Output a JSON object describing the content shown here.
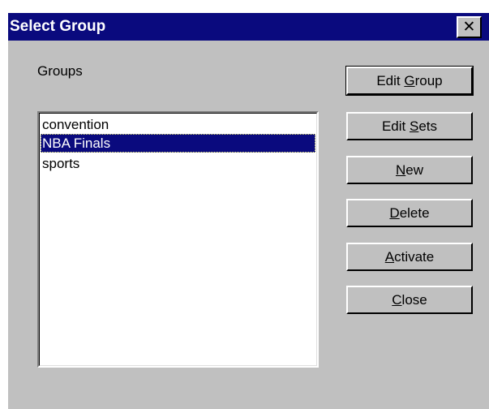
{
  "dialog": {
    "title": "Select Group",
    "close_icon": "close-icon"
  },
  "groups": {
    "label": "Groups",
    "items": [
      "convention",
      "NBA Finals",
      "sports"
    ],
    "selected": "NBA Finals"
  },
  "buttons": {
    "edit_group": {
      "pre": "Edit ",
      "accel": "G",
      "post": "roup"
    },
    "edit_sets": {
      "pre": "Edit ",
      "accel": "S",
      "post": "ets"
    },
    "new": {
      "pre": "",
      "accel": "N",
      "post": "ew"
    },
    "delete": {
      "pre": "",
      "accel": "D",
      "post": "elete"
    },
    "activate": {
      "pre": "",
      "accel": "A",
      "post": "ctivate"
    },
    "close": {
      "pre": "",
      "accel": "C",
      "post": "lose"
    }
  },
  "colors": {
    "titlebar": "#0a0a7e",
    "face": "#c0c0c0",
    "selection": "#0a0a7e"
  }
}
